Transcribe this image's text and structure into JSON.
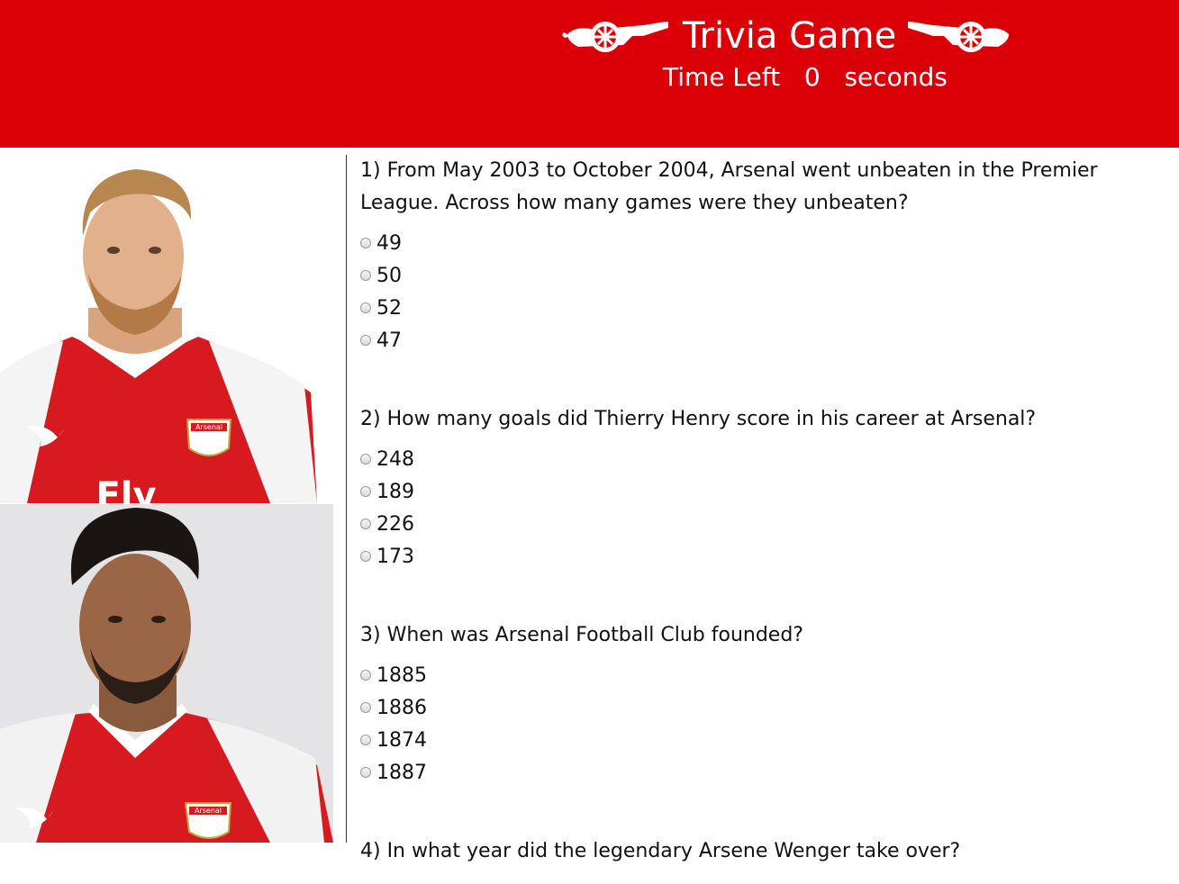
{
  "header": {
    "title": "Trivia Game",
    "timer_label": "Time Left",
    "timer_value": "0",
    "timer_unit": "seconds",
    "icon_left": "arsenal-cannon-icon",
    "icon_right": "arsenal-cannon-icon"
  },
  "colors": {
    "brand_red": "#db0007",
    "text": "#111111"
  },
  "questions": [
    {
      "text": "1) From May 2003 to October 2004, Arsenal went unbeaten in the Premier League. Across how many games were they unbeaten?",
      "options": [
        "49",
        "50",
        "52",
        "47"
      ]
    },
    {
      "text": "2) How many goals did Thierry Henry score in his career at Arsenal?",
      "options": [
        "248",
        "189",
        "226",
        "173"
      ]
    },
    {
      "text": "3) When was Arsenal Football Club founded?",
      "options": [
        "1885",
        "1886",
        "1874",
        "1887"
      ]
    },
    {
      "text": "4) In what year did the legendary Arsene Wenger take over?",
      "options": []
    }
  ],
  "sidebar": {
    "photo1_shirt_text": "Fly",
    "photo1_badge": "Arsenal",
    "photo2_badge": "Arsenal"
  }
}
